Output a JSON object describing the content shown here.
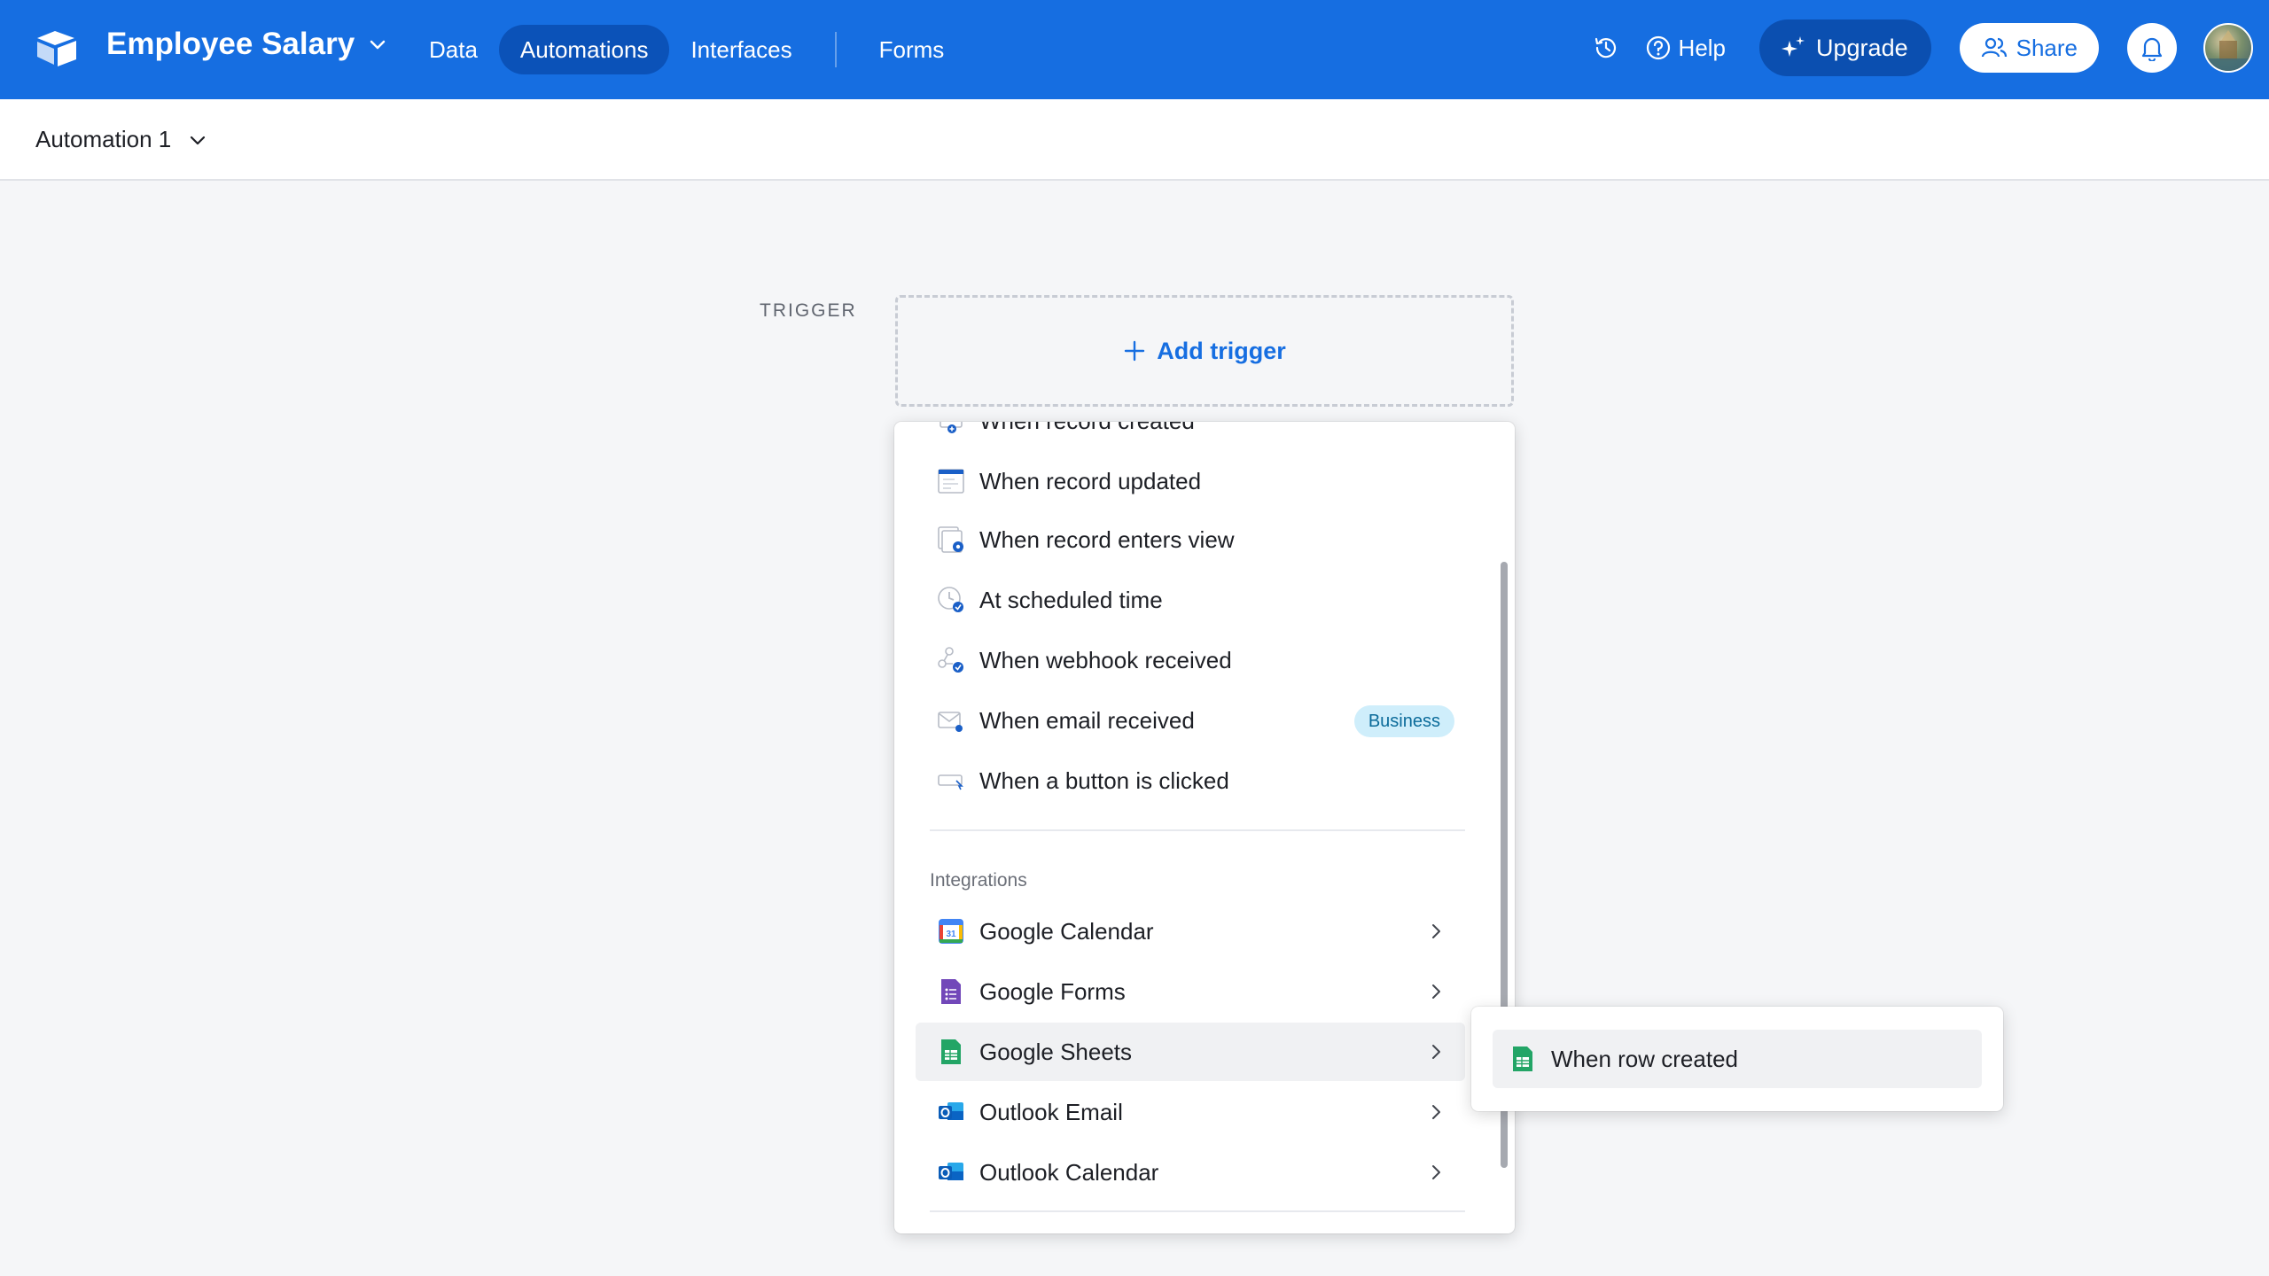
{
  "header": {
    "base_name": "Employee Salary",
    "nav": [
      {
        "label": "Data",
        "active": false
      },
      {
        "label": "Automations",
        "active": true
      },
      {
        "label": "Interfaces",
        "active": false
      },
      {
        "label": "Forms",
        "active": false
      }
    ],
    "help_label": "Help",
    "upgrade_label": "Upgrade",
    "share_label": "Share",
    "brand_color": "#166ee1"
  },
  "subbar": {
    "automation_name": "Automation 1"
  },
  "canvas": {
    "trigger_label": "TRIGGER",
    "add_trigger_label": "Add trigger"
  },
  "dropdown": {
    "triggers": [
      {
        "label": "When record created",
        "icon": "record-created-icon"
      },
      {
        "label": "When record updated",
        "icon": "record-updated-icon"
      },
      {
        "label": "When record enters view",
        "icon": "record-enters-view-icon"
      },
      {
        "label": "At scheduled time",
        "icon": "clock-icon"
      },
      {
        "label": "When webhook received",
        "icon": "webhook-icon"
      },
      {
        "label": "When email received",
        "icon": "email-icon",
        "badge": "Business"
      },
      {
        "label": "When a button is clicked",
        "icon": "button-icon"
      }
    ],
    "integrations_label": "Integrations",
    "integrations": [
      {
        "label": "Google Calendar",
        "icon": "google-calendar-icon"
      },
      {
        "label": "Google Forms",
        "icon": "google-forms-icon"
      },
      {
        "label": "Google Sheets",
        "icon": "google-sheets-icon",
        "hovered": true
      },
      {
        "label": "Outlook Email",
        "icon": "outlook-icon"
      },
      {
        "label": "Outlook Calendar",
        "icon": "outlook-calendar-icon"
      }
    ]
  },
  "submenu": {
    "items": [
      {
        "label": "When row created",
        "icon": "google-sheets-icon"
      }
    ]
  }
}
